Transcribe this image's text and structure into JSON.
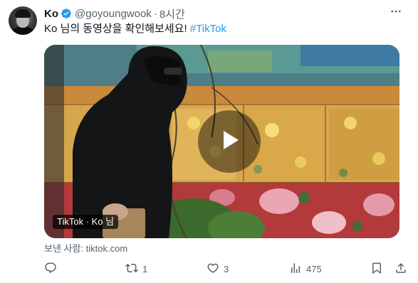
{
  "tweet": {
    "display_name": "Ko",
    "handle": "@goyoungwook",
    "separator": "·",
    "time": "8시간",
    "text": "Ko 님의 동영상을 확인해보세요! ",
    "hashtag": "#TikTok",
    "more_icon": "more-horizontal-icon",
    "verified_icon": "verified-badge-icon",
    "verified_color": "#1d9bf0"
  },
  "media": {
    "source_label": "TikTok · Ko 님",
    "play_icon": "play-icon",
    "from_line": "보낸 사람: tiktok.com"
  },
  "actions": {
    "reply": {
      "icon": "reply-icon",
      "count": ""
    },
    "retweet": {
      "icon": "retweet-icon",
      "count": "1"
    },
    "like": {
      "icon": "heart-icon",
      "count": "3"
    },
    "views": {
      "icon": "views-chart-icon",
      "count": "475"
    },
    "bookmark": {
      "icon": "bookmark-icon"
    },
    "share": {
      "icon": "share-icon"
    }
  }
}
